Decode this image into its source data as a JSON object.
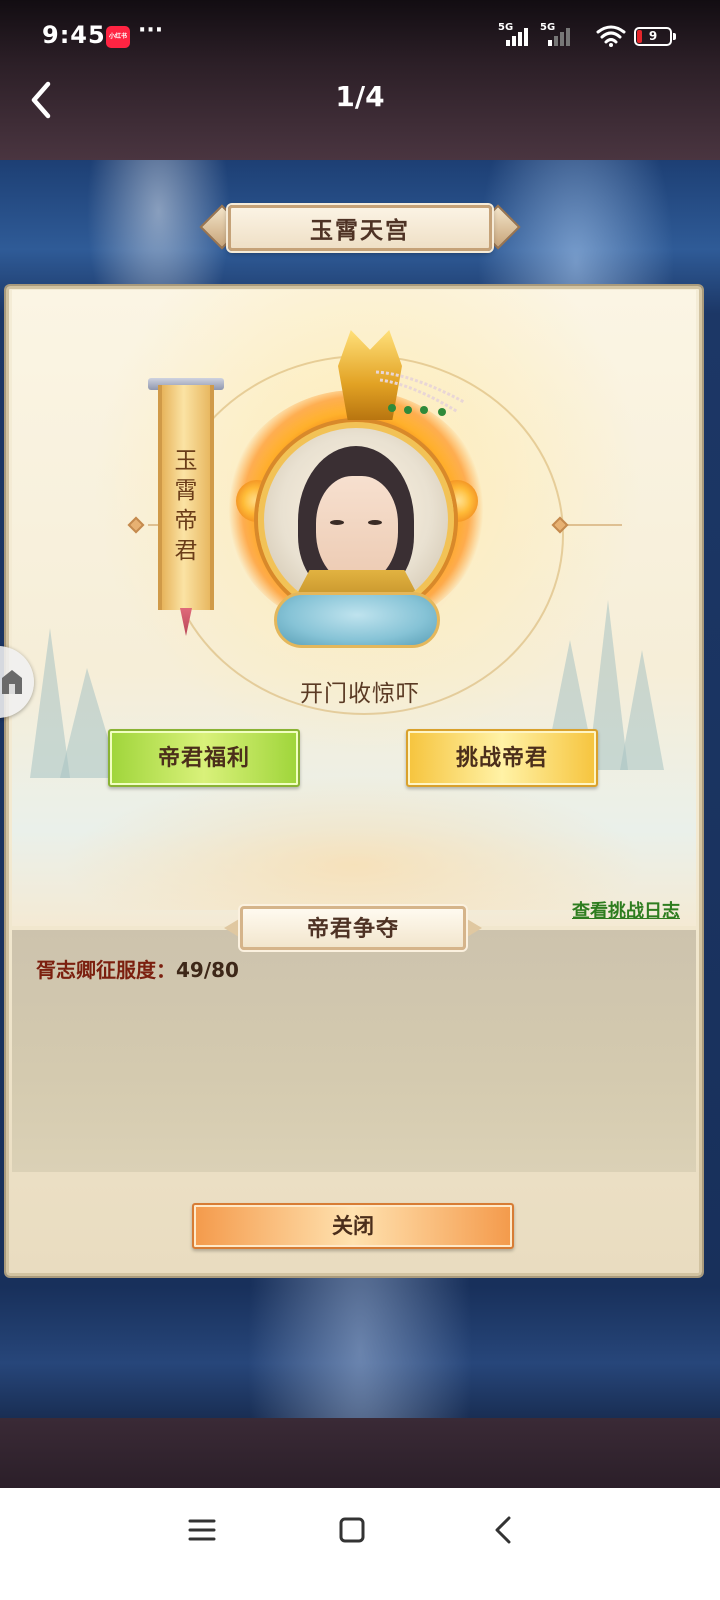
{
  "status_bar": {
    "time": "9:45",
    "app_badge": "小红书",
    "signal1_label": "5G",
    "signal2_label": "5G",
    "battery": "9"
  },
  "nav": {
    "title": "1/4"
  },
  "game": {
    "title": "玉霄天宫",
    "banner_chars": [
      "玉",
      "霄",
      "帝",
      "君"
    ],
    "motto": "开门收惊吓",
    "welfare_button": "帝君福利",
    "challenge_button": "挑战帝君",
    "log_link": "查看挑战日志",
    "section_title": "帝君争夺",
    "progress_label": "胥志卿征服度：",
    "progress_value": "49/80",
    "close_button": "关闭"
  },
  "colors": {
    "accent_green": "#9fd53a",
    "accent_gold": "#f6c43d",
    "accent_orange": "#f49a4b",
    "link_green": "#2e7d1f"
  }
}
